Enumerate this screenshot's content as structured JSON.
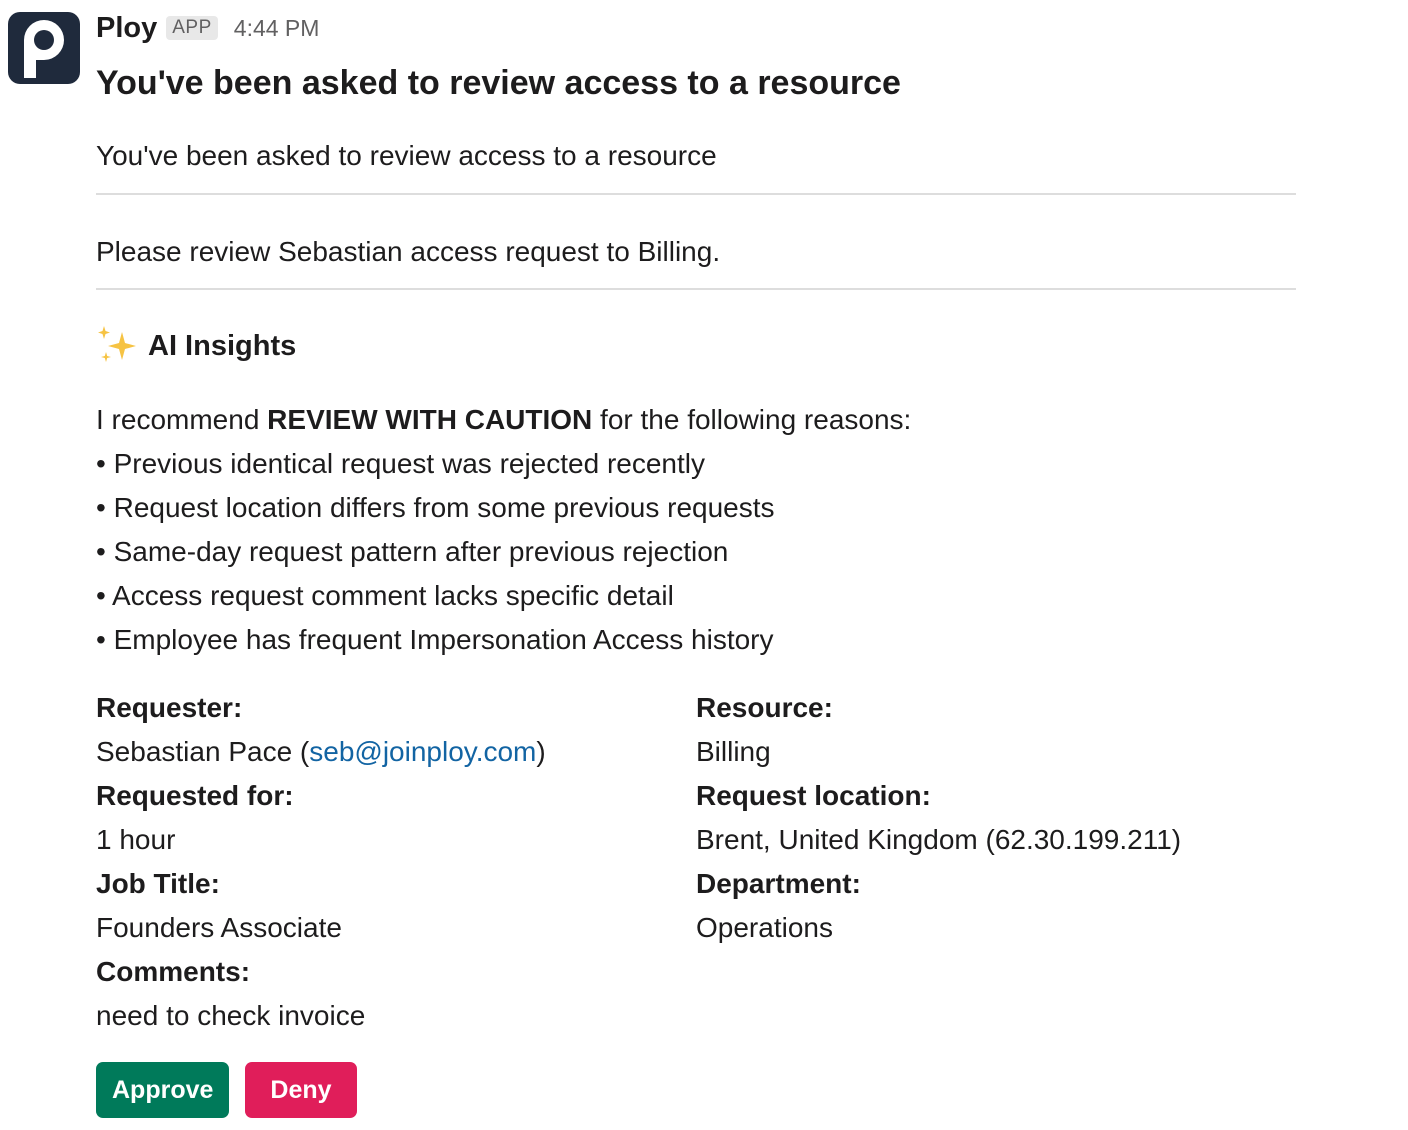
{
  "message": {
    "sender": "Ploy",
    "badge": "APP",
    "time": "4:44 PM",
    "title": "You've been asked to review access to a resource",
    "intro": "You've been asked to review access to a resource",
    "request_summary": "Please review Sebastian access request to Billing."
  },
  "insights": {
    "heading": "AI Insights",
    "rec_prefix": "I recommend ",
    "rec_strong": "REVIEW WITH CAUTION",
    "rec_suffix": " for the following reasons:",
    "reasons": [
      "Previous identical request was rejected recently",
      "Request location differs from some previous requests",
      "Same-day request pattern after previous rejection",
      "Access request comment lacks specific detail",
      "Employee has frequent Impersonation Access history"
    ]
  },
  "fields": {
    "requester_label": "Requester:",
    "requester_name": "Sebastian Pace (",
    "requester_email": "seb@joinploy.com",
    "requester_close": ")",
    "requested_for_label": "Requested for:",
    "requested_for_value": "1 hour",
    "job_title_label": "Job Title:",
    "job_title_value": "Founders Associate",
    "comments_label": "Comments:",
    "comments_value": "need to check invoice",
    "resource_label": "Resource:",
    "resource_value": "Billing",
    "location_label": "Request location:",
    "location_value": "Brent, United Kingdom (62.30.199.211)",
    "department_label": "Department:",
    "department_value": "Operations"
  },
  "actions": {
    "approve": "Approve",
    "deny": "Deny"
  },
  "colors": {
    "approve": "#007a5a",
    "deny": "#e01e5a",
    "link": "#1264a3",
    "avatar_bg": "#1f2a3c"
  },
  "icons": {
    "avatar": "ploy-logo-icon",
    "insights": "sparkles-icon"
  }
}
